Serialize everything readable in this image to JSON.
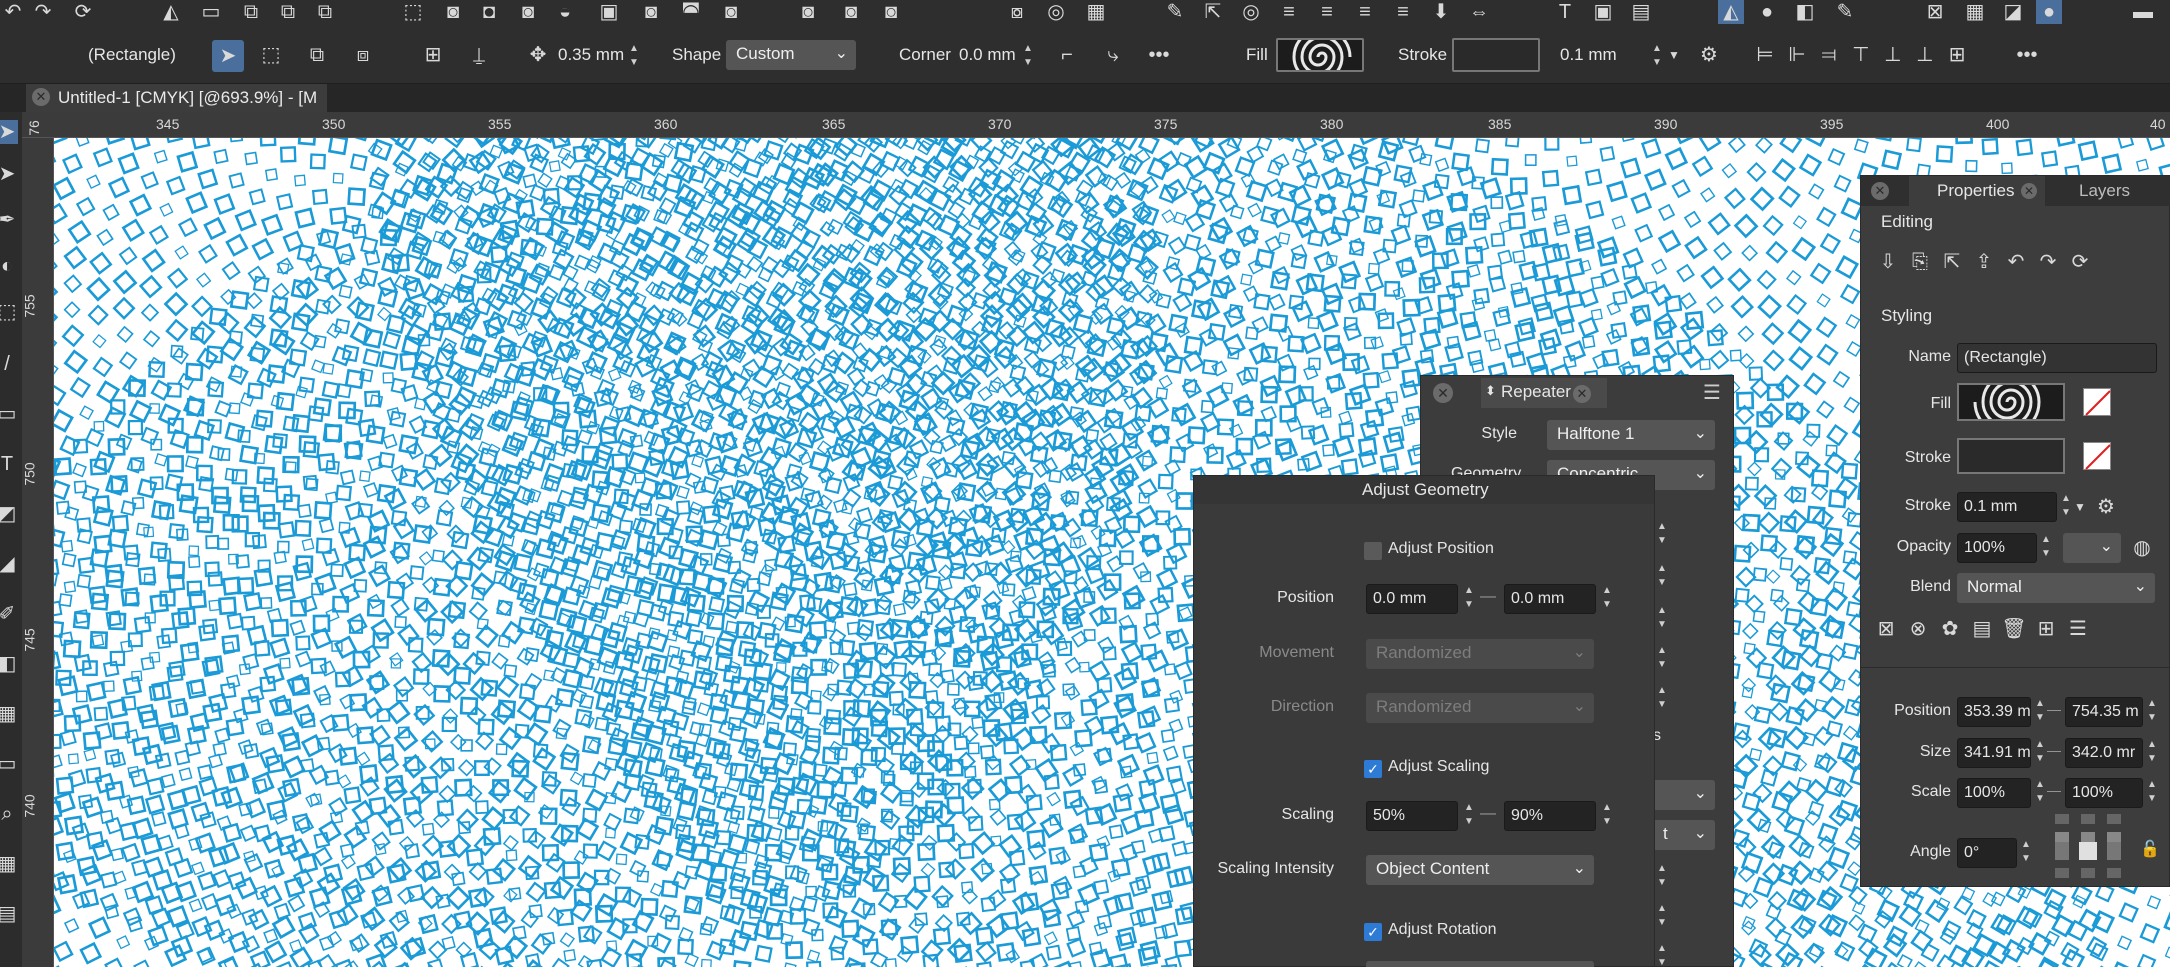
{
  "toolbar": {
    "object_label": "(Rectangle)",
    "stroke_width_value": "0.35 mm",
    "shape_label": "Shape",
    "shape_value": "Custom",
    "corner_label": "Corner",
    "corner_value": "0.0 mm",
    "fill_label": "Fill",
    "stroke_label": "Stroke",
    "stroke_value": "0.1 mm",
    "more_label": "•••"
  },
  "document": {
    "tab_title": "Untitled-1 [CMYK] [@693.9%] - [M"
  },
  "ruler": {
    "h_ticks": [
      "345",
      "350",
      "355",
      "360",
      "365",
      "370",
      "375",
      "380",
      "385",
      "390",
      "395",
      "400",
      "40"
    ],
    "v_ticks": [
      "76",
      "755",
      "750",
      "745",
      "740"
    ]
  },
  "repeater": {
    "title": "Repeater",
    "style_label": "Style",
    "style_value": "Halftone 1",
    "geometry_label": "Geometry",
    "geometry_value": "Concentric"
  },
  "adjust_geometry": {
    "title": "Adjust Geometry",
    "adjust_position_label": "Adjust Position",
    "position_label": "Position",
    "position_x": "0.0 mm",
    "position_y": "0.0 mm",
    "movement_label": "Movement",
    "movement_value": "Randomized",
    "direction_label": "Direction",
    "direction_value": "Randomized",
    "adjust_scaling_label": "Adjust Scaling",
    "scaling_label": "Scaling",
    "scaling_min": "50%",
    "scaling_max": "90%",
    "scaling_intensity_label": "Scaling Intensity",
    "scaling_intensity_value": "Object Content",
    "adjust_rotation_label": "Adjust Rotation",
    "partial_text": "s",
    "partial_text2": "t"
  },
  "properties": {
    "tab_properties": "Properties",
    "tab_layers": "Layers",
    "editing_label": "Editing",
    "styling_label": "Styling",
    "name_label": "Name",
    "name_value": "(Rectangle)",
    "fill_label": "Fill",
    "stroke_label": "Stroke",
    "stroke_width_label": "Stroke",
    "stroke_width_value": "0.1 mm",
    "opacity_label": "Opacity",
    "opacity_value": "100%",
    "blend_label": "Blend",
    "blend_value": "Normal",
    "position_label": "Position",
    "position_x": "353.39 m",
    "position_y": "754.35 m",
    "size_label": "Size",
    "size_w": "341.91 m",
    "size_h": "342.0 mr",
    "scale_label": "Scale",
    "scale_x": "100%",
    "scale_y": "100%",
    "angle_label": "Angle",
    "angle_value": "0°"
  },
  "colors": {
    "accent": "#2e7bd6",
    "pattern": "#1a9ad6",
    "panel": "#3d3d3d",
    "toolbar": "#2e2e2e"
  }
}
